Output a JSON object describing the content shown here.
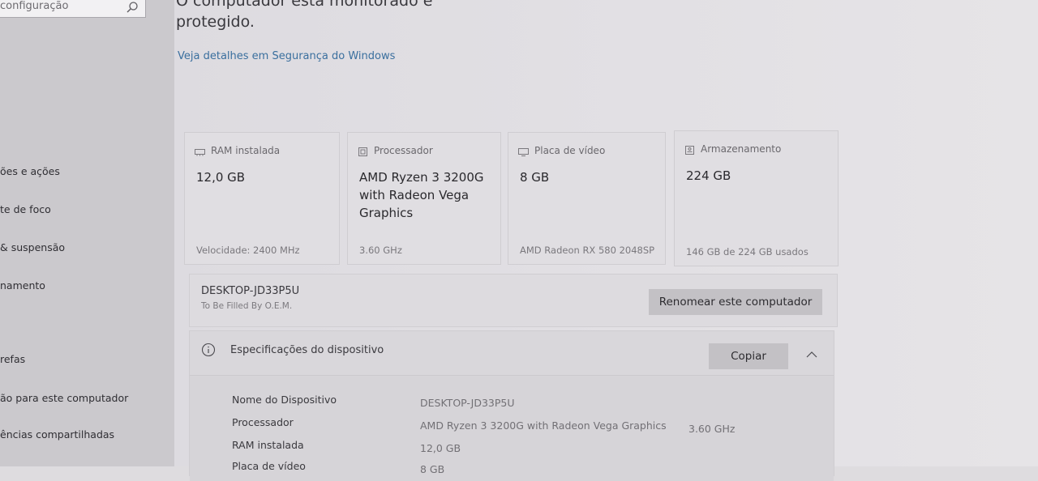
{
  "sidebar": {
    "search_placeholder": "configuração",
    "items": [
      {
        "label": "ões e ações"
      },
      {
        "label": "te de foco"
      },
      {
        "label": "& suspensão"
      },
      {
        "label": "namento"
      },
      {
        "label": "refas"
      },
      {
        "label": "ão para este computador"
      },
      {
        "label": "ências compartilhadas"
      }
    ]
  },
  "status": {
    "line1": "O computador está monitorado e",
    "line2": "protegido.",
    "link": "Veja detalhes em Segurança do Windows"
  },
  "cards": [
    {
      "label": "RAM instalada",
      "value": "12,0 GB",
      "foot": "Velocidade: 2400 MHz",
      "icon": "ram-icon"
    },
    {
      "label": "Processador",
      "value": "AMD Ryzen 3 3200G with Radeon Vega Graphics",
      "foot": "3.60 GHz",
      "icon": "processor-icon"
    },
    {
      "label": "Placa de vídeo",
      "value": "8 GB",
      "foot": "AMD Radeon RX 580 2048SP",
      "icon": "gpu-icon"
    },
    {
      "label": "Armazenamento",
      "value": "224 GB",
      "foot": "146 GB de 224 GB usados",
      "icon": "storage-icon"
    }
  ],
  "device": {
    "name": "DESKTOP-JD33P5U",
    "subtitle": "To Be Filled By O.E.M.",
    "rename_label": "Renomear este computador"
  },
  "specs": {
    "title": "Especificações do dispositivo",
    "copy_label": "Copiar",
    "rows": [
      {
        "label": "Nome do Dispositivo",
        "value": "DESKTOP-JD33P5U",
        "extra": ""
      },
      {
        "label": "Processador",
        "value": "AMD Ryzen 3 3200G with Radeon Vega Graphics",
        "extra": "3.60 GHz"
      },
      {
        "label": "RAM instalada",
        "value": "12,0 GB",
        "extra": ""
      },
      {
        "label": "Placa de vídeo",
        "value": "8 GB",
        "extra": ""
      }
    ]
  }
}
